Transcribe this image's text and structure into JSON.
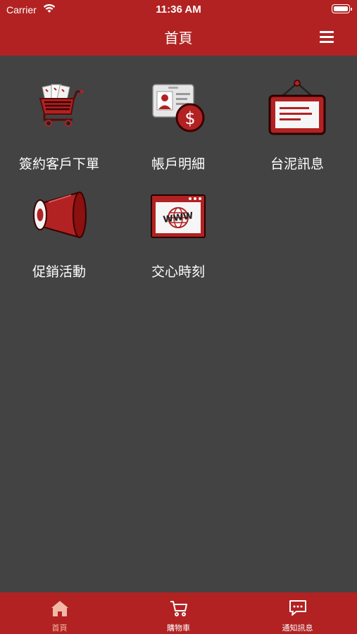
{
  "status_bar": {
    "carrier": "Carrier",
    "time": "11:36 AM"
  },
  "header": {
    "title": "首頁",
    "menu_icon": "hamburger-menu-icon"
  },
  "menu_tiles": [
    {
      "label": "簽約客戶下單",
      "icon": "shopping-cart-icon"
    },
    {
      "label": "帳戶明細",
      "icon": "account-card-dollar-icon"
    },
    {
      "label": "台泥訊息",
      "icon": "hanging-sign-icon"
    },
    {
      "label": "促銷活動",
      "icon": "megaphone-icon"
    },
    {
      "label": "交心時刻",
      "icon": "www-browser-icon"
    }
  ],
  "tab_bar": {
    "tabs": [
      {
        "label": "首頁",
        "icon": "home-icon",
        "active": true
      },
      {
        "label": "購物車",
        "icon": "cart-icon",
        "active": false
      },
      {
        "label": "通知訊息",
        "icon": "chat-bubble-icon",
        "active": false
      }
    ]
  },
  "colors": {
    "brand_red": "#b22222",
    "background": "#434343",
    "active_tab": "#f3b9a6"
  }
}
